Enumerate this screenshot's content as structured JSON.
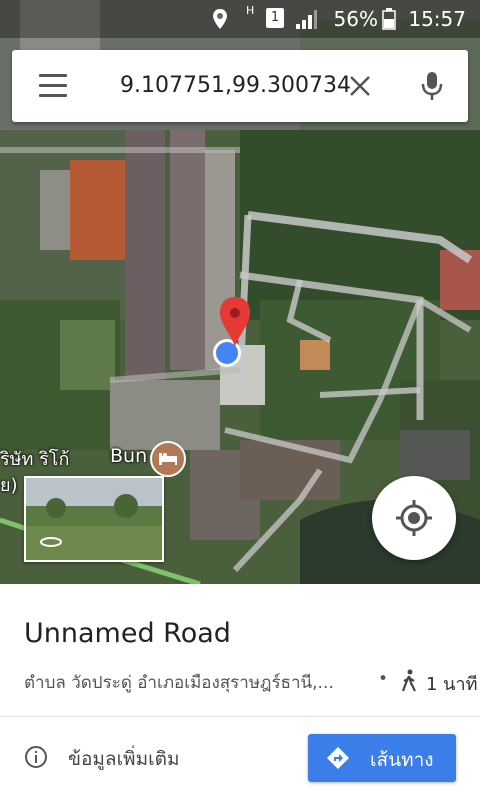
{
  "status_bar": {
    "time": "15:57",
    "battery": "56%",
    "network": "H",
    "sim": "1"
  },
  "search": {
    "query": "9.107751,99.300734"
  },
  "map": {
    "poi_label": "Bun",
    "edge_labels": [
      "ริษัท ริโก้",
      "ย)"
    ],
    "colors": {
      "road": "#c9c9c9",
      "vegetation": "#3e5a2e",
      "pin": "#e53935",
      "location_dot": "#4285f4"
    }
  },
  "place": {
    "title": "Unnamed Road",
    "address": "ตำบล วัดประดู่ อำเภอเมืองสุราษฎร์ธานี,...",
    "separator": "•",
    "walk_time": "1 นาที"
  },
  "actions": {
    "more_info": "ข้อมูลเพิ่มเติม",
    "directions": "เส้นทาง"
  },
  "icons": [
    "menu-icon",
    "clear-icon",
    "mic-icon",
    "my-location-icon",
    "street-view-icon",
    "hotel-icon",
    "walk-icon",
    "info-icon",
    "directions-icon"
  ]
}
